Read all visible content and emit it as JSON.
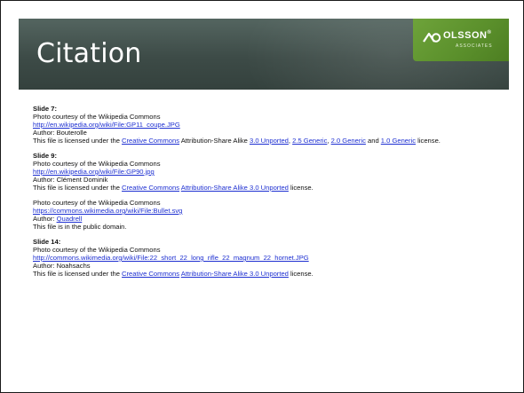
{
  "title": "Citation",
  "logo": {
    "text": "OLSSON",
    "registered": "®",
    "subtext": "ASSOCIATES",
    "color": "#5a8f2b"
  },
  "colors": {
    "banner": "#3d4b47",
    "link": "#1d2fd1",
    "text": "#111111"
  },
  "citations": [
    {
      "heading": "Slide 7:",
      "courtesy": "Photo courtesy of the Wikipedia Commons",
      "url": "http://en.wikipedia.org/wiki/File:GP11_coupe.JPG",
      "author_prefix": "Author: ",
      "author": "Bouterolle",
      "license": {
        "prefix": "This file is licensed under the ",
        "cc": "Creative Commons",
        "mid": " Attribution-Share Alike ",
        "v1": "3.0 Unported",
        "sep1": ", ",
        "v2": "2.5 Generic",
        "sep2": ", ",
        "v3": "2.0 Generic",
        "sep3": " and ",
        "v4": "1.0 Generic",
        "suffix": " license."
      }
    },
    {
      "heading": "Slide 9:",
      "courtesy": "Photo courtesy of the Wikipedia Commons",
      "url": "http://en.wikipedia.org/wiki/File:GP90.jpg",
      "author_prefix": "Author: ",
      "author": "Clément Dominik",
      "license": {
        "prefix": "This file is licensed under the ",
        "cc": "Creative Commons",
        "space": " ",
        "attr": "Attribution-Share Alike 3.0 Unported",
        "suffix": " license."
      }
    },
    {
      "courtesy": "Photo courtesy of the Wikipedia Commons",
      "url": "https://commons.wikimedia.org/wiki/File:Bullet.svg",
      "author_prefix": "Author: ",
      "author": "Quadrell",
      "note": "This file is in the public domain."
    },
    {
      "heading": "Slide 14:",
      "courtesy": "Photo courtesy of the Wikipedia Commons",
      "url": "http://commons.wikimedia.org/wiki/File:22_short_22_long_rifle_22_magnum_22_hornet.JPG",
      "author_prefix": "Author: ",
      "author": "Noahsachs",
      "license": {
        "prefix": "This file is licensed under the ",
        "cc": "Creative Commons",
        "space": " ",
        "attr": "Attribution-Share Alike 3.0 Unported",
        "suffix": " license."
      }
    }
  ]
}
